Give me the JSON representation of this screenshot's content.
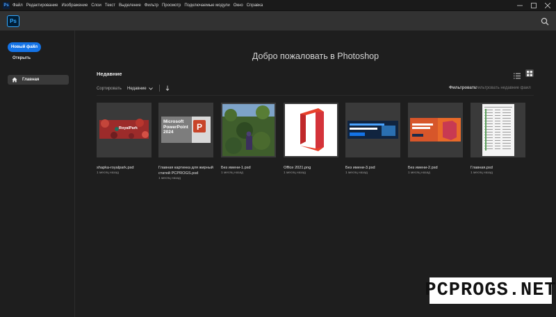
{
  "menubar": {
    "logo": "Ps",
    "items": [
      "Файл",
      "Редактирование",
      "Изображение",
      "Слои",
      "Текст",
      "Выделение",
      "Фильтр",
      "Просмотр",
      "Подключаемые модули",
      "Окно",
      "Справка"
    ]
  },
  "appbar": {
    "logo": "Ps"
  },
  "sidebar": {
    "new_file": "Новый файл",
    "open": "Открыть",
    "home": "Главная"
  },
  "main": {
    "welcome": "Добро пожаловать в Photoshop",
    "recent_title": "Недавние",
    "sort_label": "Сортировать",
    "sort_value": "Недавние",
    "filter_label": "Фильтровать",
    "filter_placeholder": "Фильтровать недавние файл"
  },
  "files": [
    {
      "name": "shapka-royalpark.psd",
      "date": "1 месяц назад",
      "thumb_text": "RoyalPark"
    },
    {
      "name": "Главная картинка для жирный статей PCPROGS.psd",
      "date": "1 месяц назад",
      "thumb_text": "Microsoft PowerPoint 2024"
    },
    {
      "name": "Без имени-1.psd",
      "date": "1 месяц назад"
    },
    {
      "name": "Office 2021.png",
      "date": "1 месяц назад"
    },
    {
      "name": "Без имени-3.psd",
      "date": "1 месяц назад"
    },
    {
      "name": "Без имени-2.psd",
      "date": "1 месяц назад"
    },
    {
      "name": "Главная.psd",
      "date": "1 месяц назад"
    }
  ],
  "watermark": "PCPROGS.NET",
  "colors": {
    "accent": "#1473e6",
    "ps_blue": "#31a8ff",
    "background": "#1e1e1e"
  }
}
